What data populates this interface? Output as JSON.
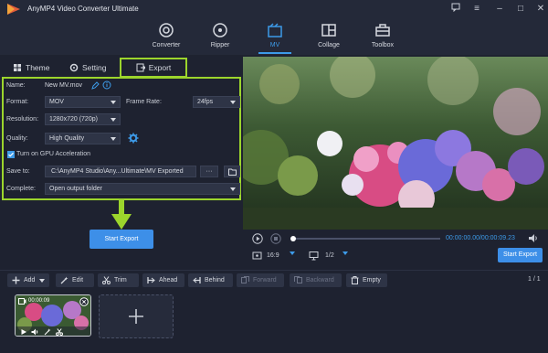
{
  "app": {
    "title": "AnyMP4 Video Converter Ultimate"
  },
  "nav": [
    {
      "label": "Converter",
      "icon": "converter-icon"
    },
    {
      "label": "Ripper",
      "icon": "ripper-icon"
    },
    {
      "label": "MV",
      "icon": "mv-icon",
      "active": true
    },
    {
      "label": "Collage",
      "icon": "collage-icon"
    },
    {
      "label": "Toolbox",
      "icon": "toolbox-icon"
    }
  ],
  "tabs": {
    "theme": "Theme",
    "setting": "Setting",
    "export": "Export"
  },
  "export": {
    "name_label": "Name:",
    "name_value": "New MV.mov",
    "format_label": "Format:",
    "format_value": "MOV",
    "frame_rate_label": "Frame Rate:",
    "frame_rate_value": "24fps",
    "resolution_label": "Resolution:",
    "resolution_value": "1280x720 (720p)",
    "quality_label": "Quality:",
    "quality_value": "High Quality",
    "gpu_label": "Turn on GPU Acceleration",
    "gpu_checked": true,
    "save_label": "Save to:",
    "save_value": "C:\\AnyMP4 Studio\\Any...Ultimate\\MV Exported",
    "save_more": "···",
    "complete_label": "Complete:",
    "complete_value": "Open output folder",
    "start_button": "Start Export"
  },
  "player": {
    "time": "00:00:00.00/00:00:09.23",
    "aspect": "16:9",
    "page": "1/2",
    "start_button": "Start Export",
    "progress": 0.0
  },
  "toolbar": {
    "add": "Add",
    "edit": "Edit",
    "trim": "Trim",
    "ahead": "Ahead",
    "behind": "Behind",
    "forward": "Forward",
    "backward": "Backward",
    "empty": "Empty",
    "page": "1 / 1"
  },
  "clip": {
    "time": "00:00:09"
  },
  "colors": {
    "accent": "#3d8fe8",
    "highlight": "#9cd52c",
    "bg": "#1e2230"
  }
}
